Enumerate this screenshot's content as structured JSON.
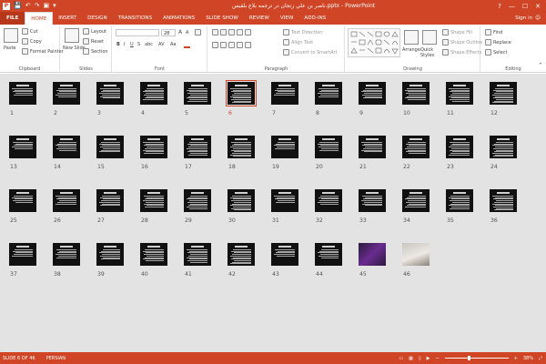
{
  "window": {
    "title": "ناصر بن علي زنجان در ترجمه بلاغ بلقیس.pptx - PowerPoint",
    "help": "?",
    "minimize": "—",
    "maximize": "☐",
    "close": "✕"
  },
  "quick_access": {
    "save": "💾",
    "undo": "↶",
    "redo": "↷",
    "start": "▣",
    "customize": "▾"
  },
  "tabs": [
    "FILE",
    "HOME",
    "INSERT",
    "DESIGN",
    "TRANSITIONS",
    "ANIMATIONS",
    "SLIDE SHOW",
    "REVIEW",
    "VIEW",
    "ADD-INS"
  ],
  "active_tab": "HOME",
  "signin": "Sign in",
  "ribbon": {
    "clipboard": {
      "paste": "Paste",
      "cut": "Cut",
      "copy": "Copy",
      "format_painter": "Format Painter",
      "label": "Clipboard"
    },
    "slides": {
      "new_slide": "New Slide",
      "layout": "Layout",
      "reset": "Reset",
      "section": "Section",
      "label": "Slides"
    },
    "font": {
      "label": "Font",
      "size": "28",
      "bold": "B",
      "italic": "I",
      "underline": "U",
      "strike": "S",
      "shadow": "abc",
      "spacing": "AV",
      "case": "Aa",
      "grow": "A",
      "shrink": "A"
    },
    "paragraph": {
      "text_direction": "Text Direction",
      "align_text": "Align Text",
      "smartart": "Convert to SmartArt",
      "label": "Paragraph"
    },
    "drawing": {
      "arrange": "Arrange",
      "quick_styles": "Quick Styles",
      "shape_fill": "Shape Fill",
      "shape_outline": "Shape Outline",
      "shape_effects": "Shape Effects",
      "label": "Drawing"
    },
    "editing": {
      "find": "Find",
      "replace": "Replace",
      "select": "Select",
      "label": "Editing"
    }
  },
  "slides": [
    "1",
    "2",
    "3",
    "4",
    "5",
    "6",
    "7",
    "8",
    "9",
    "10",
    "11",
    "12",
    "13",
    "14",
    "15",
    "16",
    "17",
    "18",
    "19",
    "20",
    "21",
    "22",
    "23",
    "24",
    "25",
    "26",
    "27",
    "28",
    "29",
    "30",
    "31",
    "32",
    "33",
    "34",
    "35",
    "36",
    "37",
    "38",
    "39",
    "40",
    "41",
    "42",
    "43",
    "44",
    "45",
    "46"
  ],
  "selected_slide": 6,
  "status": {
    "slide_of": "SLIDE 6 OF 46",
    "language": "PERSIAN",
    "zoom": "38%",
    "zoom_minus": "−",
    "zoom_plus": "+",
    "zoom_fraction": 0.38
  }
}
